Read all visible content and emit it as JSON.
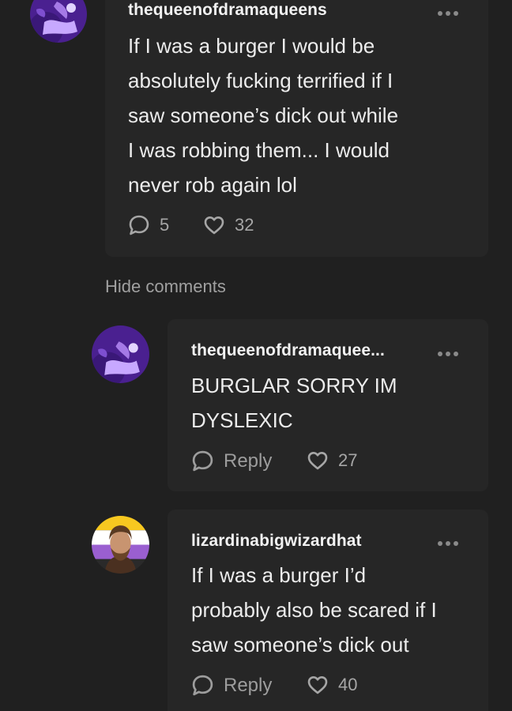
{
  "post": {
    "username": "thequeenofdramaqueens",
    "text_lines": [
      "If I was a burger I would be",
      "absolutely fucking terrified if I",
      "saw someone’s dick out while",
      "I was robbing them... I would",
      "never rob again lol"
    ],
    "replies_count": "5",
    "likes_count": "32",
    "icons": {
      "avatar": "purple-abstract-avatar",
      "reply": "speech-bubble-icon",
      "like": "heart-icon",
      "more": "more-options-icon"
    }
  },
  "hide_comments_label": "Hide comments",
  "comments": [
    {
      "username": "thequeenofdramaquee...",
      "text_lines": [
        "BURGLAR SORRY IM",
        "DYSLEXIC"
      ],
      "reply_label": "Reply",
      "likes_count": "27",
      "avatar": "purple-abstract-avatar"
    },
    {
      "username": "lizardinabigwizardhat",
      "text_lines": [
        "If I was a burger I’d",
        "probably also be scared if I",
        "saw someone’s dick out"
      ],
      "reply_label": "Reply",
      "likes_count": "40",
      "avatar": "bearded-man-pride-flag-avatar"
    }
  ],
  "colors": {
    "background": "#202020",
    "card": "#262626",
    "text": "#ececec",
    "muted": "#a0a0a0",
    "avatar_purple": "#5b2ea6",
    "avatar_purple_light": "#b690f0"
  }
}
